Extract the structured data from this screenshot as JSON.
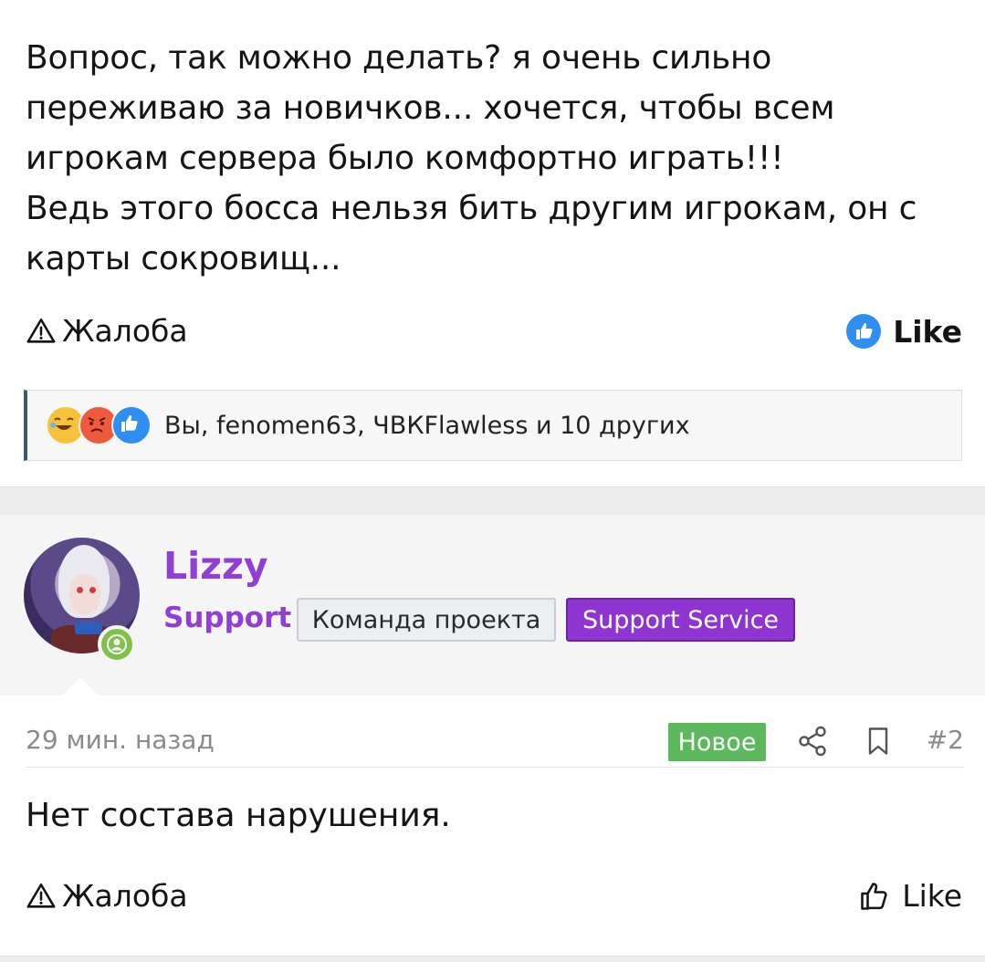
{
  "post1": {
    "lines": [
      "Вопрос, так можно делать? я очень сильно",
      "переживаю за новичков... хочется, чтобы всем",
      "игрокам сервера было комфортно играть!!!",
      "Ведь этого босса нельзя бить другим игрокам, он с",
      "карты сокровищ..."
    ],
    "report_label": "Жалоба",
    "like_label": "Like",
    "reactions": {
      "icons": [
        "laugh-emoji-icon",
        "angry-emoji-icon",
        "thumbs-up-icon"
      ],
      "summary": "Вы, fenomen63, ЧВКFlawless и 10 других"
    }
  },
  "post2": {
    "user": {
      "name": "Lizzy",
      "title": "Support",
      "banners": [
        "Команда проекта",
        "Support Service"
      ]
    },
    "time": "29 мин. назад",
    "new_label": "Новое",
    "number": "#2",
    "text": "Нет состава нарушения.",
    "report_label": "Жалоба",
    "like_label": "Like"
  },
  "colors": {
    "username": "#8f3fd4",
    "support_banner": "#8e34d0",
    "new_badge": "#5cb85c",
    "online": "#7ec24a",
    "like_blue": "#2f8ef1"
  }
}
